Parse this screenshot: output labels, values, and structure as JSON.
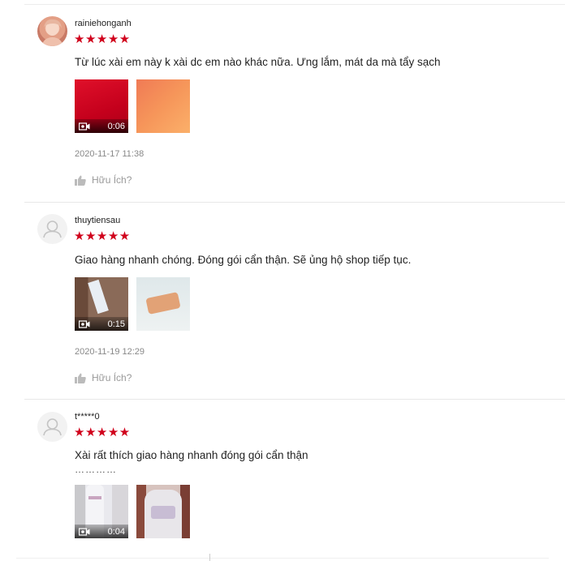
{
  "reviews": [
    {
      "username": "rainiehonganh",
      "stars": "★★★★★",
      "comment": "Từ lúc xài em này k xài dc em nào khác nữa. Ưng lắm, mát da mà tẩy sạch",
      "media": [
        {
          "type": "video",
          "duration": "0:06"
        },
        {
          "type": "image"
        }
      ],
      "date": "2020-11-17 11:38",
      "helpful_label": "Hữu Ích?"
    },
    {
      "username": "thuytiensau",
      "stars": "★★★★★",
      "comment": "Giao hàng nhanh chóng. Đóng gói cẩn thận. Sẽ ủng hộ shop tiếp tục.",
      "media": [
        {
          "type": "video",
          "duration": "0:15"
        },
        {
          "type": "image"
        }
      ],
      "date": "2020-11-19 12:29",
      "helpful_label": "Hữu Ích?"
    },
    {
      "username": "t*****0",
      "stars": "★★★★★",
      "comment": "Xài rất thích giao hàng nhanh đóng gói cẩn thận",
      "extra": "…………",
      "media": [
        {
          "type": "video",
          "duration": "0:04"
        },
        {
          "type": "image"
        }
      ]
    }
  ],
  "colors": {
    "star": "#d0011b",
    "text": "#222222",
    "muted": "#888888"
  },
  "icons": [
    "user-avatar-icon",
    "star-icon",
    "video-camera-icon",
    "thumbs-up-icon"
  ]
}
